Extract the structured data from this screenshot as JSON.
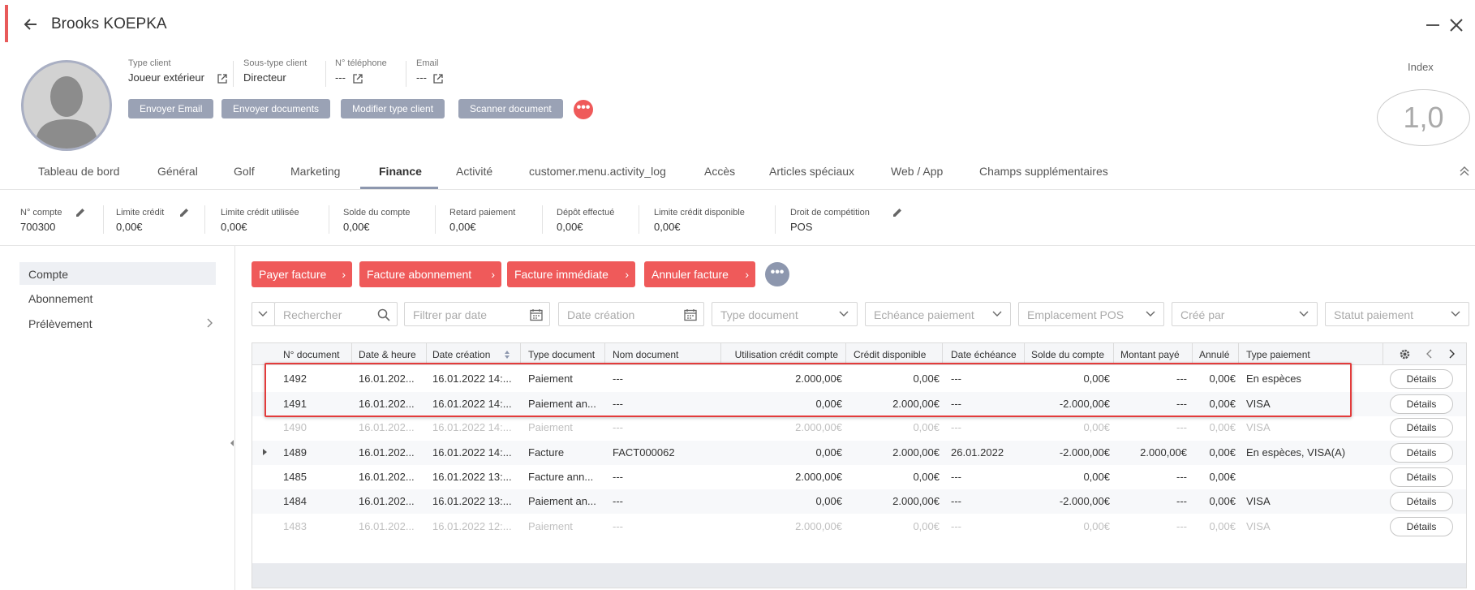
{
  "header": {
    "title": "Brooks KOEPKA"
  },
  "client_info": {
    "type_client": {
      "label": "Type client",
      "value": "Joueur extérieur"
    },
    "sous_type": {
      "label": "Sous-type client",
      "value": "Directeur"
    },
    "telephone": {
      "label": "N° téléphone",
      "value": "---"
    },
    "email": {
      "label": "Email",
      "value": "---"
    }
  },
  "actions": {
    "envoyer_email": "Envoyer Email",
    "envoyer_documents": "Envoyer documents",
    "modifier_type": "Modifier type client",
    "scanner_document": "Scanner document",
    "more": "•••"
  },
  "index": {
    "label": "Index",
    "value": "1,0"
  },
  "tabs": [
    {
      "label": "Tableau de bord"
    },
    {
      "label": "Général"
    },
    {
      "label": "Golf"
    },
    {
      "label": "Marketing"
    },
    {
      "label": "Finance",
      "active": true
    },
    {
      "label": "Activité"
    },
    {
      "label": "customer.menu.activity_log"
    },
    {
      "label": "Accès"
    },
    {
      "label": "Articles spéciaux"
    },
    {
      "label": "Web / App"
    },
    {
      "label": "Champs supplémentaires"
    }
  ],
  "summary": [
    {
      "label": "N° compte",
      "value": "700300"
    },
    {
      "label": "Limite crédit",
      "value": "0,00€"
    },
    {
      "label": "Limite crédit utilisée",
      "value": "0,00€"
    },
    {
      "label": "Solde du compte",
      "value": "0,00€"
    },
    {
      "label": "Retard paiement",
      "value": "0,00€"
    },
    {
      "label": "Dépôt effectué",
      "value": "0,00€"
    },
    {
      "label": "Limite crédit disponible",
      "value": "0,00€"
    },
    {
      "label": "Droit de compétition",
      "value": "POS"
    }
  ],
  "left_nav": [
    {
      "label": "Compte",
      "active": true
    },
    {
      "label": "Abonnement"
    },
    {
      "label": "Prélèvement"
    }
  ],
  "finance_actions": {
    "payer_facture": "Payer facture",
    "facture_abonnement": "Facture abonnement",
    "facture_immediate": "Facture immédiate",
    "annuler_facture": "Annuler facture",
    "chevron": "›",
    "more": "•••"
  },
  "filters": {
    "rechercher": "Rechercher",
    "filtrer_date": "Filtrer par date",
    "date_creation": "Date création",
    "type_document": "Type document",
    "echeance": "Echéance paiement",
    "emplacement": "Emplacement POS",
    "cree_par": "Créé par",
    "statut": "Statut paiement"
  },
  "table": {
    "columns": [
      "N° document",
      "Date & heure",
      "Date création",
      "Type document",
      "Nom document",
      "Utilisation crédit compte",
      "Crédit disponible",
      "Date échéance",
      "Solde du compte",
      "Montant payé",
      "Annulé",
      "Type paiement"
    ],
    "details_label": "Détails",
    "rows": [
      {
        "doc": "1492",
        "date": "16.01.202...",
        "created": "16.01.2022 14:...",
        "type": "Paiement",
        "name": "---",
        "credit_used": "2.000,00€",
        "credit_avail": "0,00€",
        "due": "---",
        "balance": "0,00€",
        "paid": "---",
        "cancelled": "0,00€",
        "payment": "En espèces",
        "dim": false
      },
      {
        "doc": "1491",
        "date": "16.01.202...",
        "created": "16.01.2022 14:...",
        "type": "Paiement an...",
        "name": "---",
        "credit_used": "0,00€",
        "credit_avail": "2.000,00€",
        "due": "---",
        "balance": "-2.000,00€",
        "paid": "---",
        "cancelled": "0,00€",
        "payment": "VISA",
        "dim": false
      },
      {
        "doc": "1490",
        "date": "16.01.202...",
        "created": "16.01.2022 14:...",
        "type": "Paiement",
        "name": "---",
        "credit_used": "2.000,00€",
        "credit_avail": "0,00€",
        "due": "---",
        "balance": "0,00€",
        "paid": "---",
        "cancelled": "0,00€",
        "payment": "VISA",
        "dim": true
      },
      {
        "doc": "1489",
        "date": "16.01.202...",
        "created": "16.01.2022 14:...",
        "type": "Facture",
        "name": "FACT000062",
        "credit_used": "0,00€",
        "credit_avail": "2.000,00€",
        "due": "26.01.2022",
        "balance": "-2.000,00€",
        "paid": "2.000,00€",
        "cancelled": "0,00€",
        "payment": "En espèces, VISA(A)",
        "dim": false
      },
      {
        "doc": "1485",
        "date": "16.01.202...",
        "created": "16.01.2022 13:...",
        "type": "Facture ann...",
        "name": "---",
        "credit_used": "2.000,00€",
        "credit_avail": "0,00€",
        "due": "---",
        "balance": "0,00€",
        "paid": "---",
        "cancelled": "0,00€",
        "payment": "",
        "dim": false
      },
      {
        "doc": "1484",
        "date": "16.01.202...",
        "created": "16.01.2022 13:...",
        "type": "Paiement an...",
        "name": "---",
        "credit_used": "0,00€",
        "credit_avail": "2.000,00€",
        "due": "---",
        "balance": "-2.000,00€",
        "paid": "---",
        "cancelled": "0,00€",
        "payment": "VISA",
        "dim": false
      },
      {
        "doc": "1483",
        "date": "16.01.202...",
        "created": "16.01.2022 12:...",
        "type": "Paiement",
        "name": "---",
        "credit_used": "2.000,00€",
        "credit_avail": "0,00€",
        "due": "---",
        "balance": "0,00€",
        "paid": "---",
        "cancelled": "0,00€",
        "payment": "VISA",
        "dim": true
      }
    ]
  },
  "colors": {
    "accent_red": "#ef5a5a",
    "gray_button": "#9aa2b5",
    "highlight": "#e33b3b"
  }
}
